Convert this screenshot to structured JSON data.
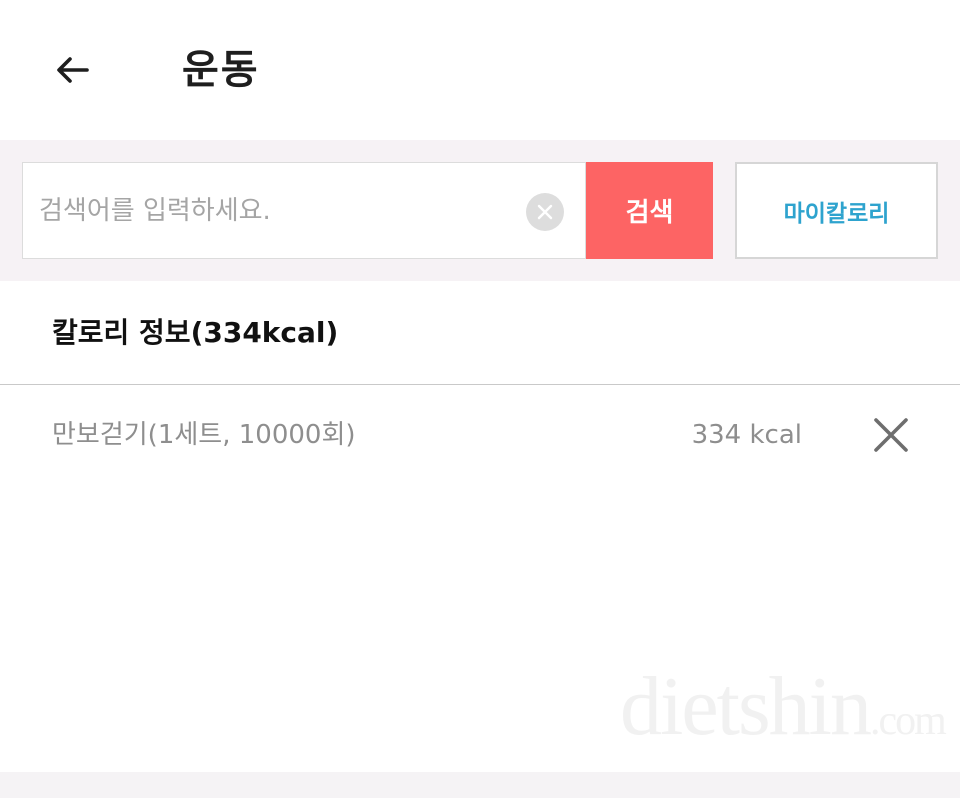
{
  "header": {
    "back_icon": "arrow-left-icon",
    "title": "운동"
  },
  "search": {
    "placeholder": "검색어를 입력하세요.",
    "value": "",
    "clear_icon": "close-circle-icon",
    "button_label": "검색",
    "my_calorie_label": "마이칼로리",
    "button_color": "#fd6464",
    "my_calorie_color": "#2ea3ce"
  },
  "calorie_info": {
    "title": "칼로리 정보",
    "total": "(334kcal)"
  },
  "exercises": [
    {
      "name": "만보걷기(1세트, 10000회)",
      "kcal": "334 kcal",
      "delete_icon": "close-icon"
    }
  ],
  "watermark": {
    "brand": "dietshin",
    "suffix": ".com"
  }
}
